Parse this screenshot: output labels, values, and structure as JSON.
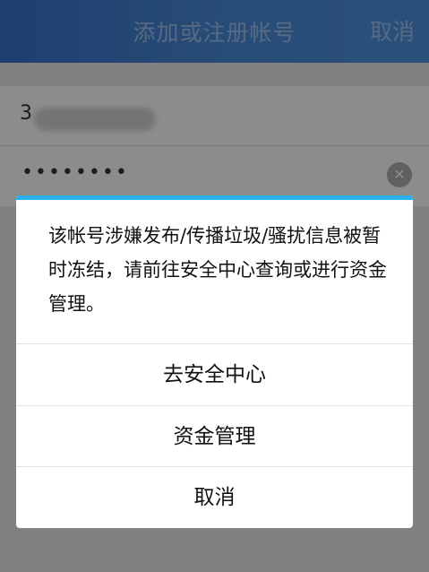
{
  "nav": {
    "title": "添加或注册帐号",
    "cancel_label": "取消"
  },
  "form": {
    "account_value": "3",
    "password_masked": "••••••••",
    "clear_icon": "clear-circle-icon"
  },
  "dialog": {
    "message": "该帐号涉嫌发布/传播垃圾/骚扰信息被暂时冻结，请前往安全中心查询或进行资金管理。",
    "options": [
      "去安全中心",
      "资金管理",
      "取消"
    ],
    "accent_color": "#27b0ec"
  }
}
